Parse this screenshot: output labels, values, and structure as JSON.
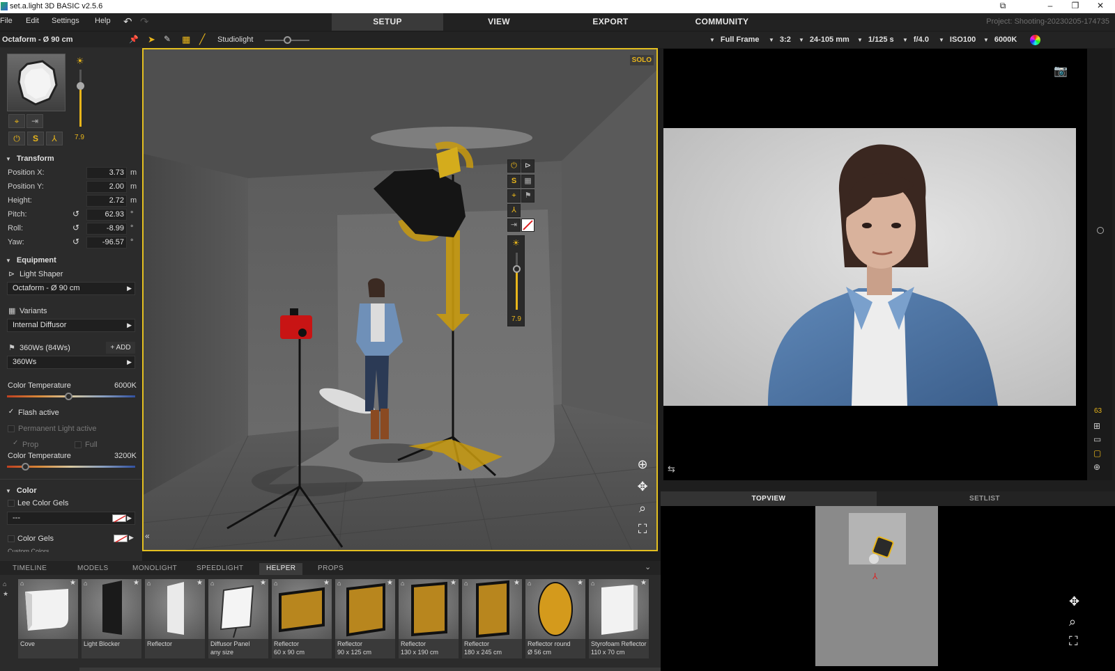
{
  "window": {
    "title": "set.a.light 3D BASIC v2.5.6"
  },
  "menu": {
    "items": [
      "File",
      "Edit",
      "Settings",
      "Help"
    ]
  },
  "main_tabs": [
    "SETUP",
    "VIEW",
    "EXPORT",
    "COMMUNITY"
  ],
  "project": "Project: Shooting-20230205-174735",
  "left_panel": {
    "header": "Octaform - Ø 90 cm",
    "power_value": "7.9",
    "transform": {
      "label": "Transform",
      "fields": [
        {
          "label": "Position X:",
          "value": "3.73",
          "unit": "m"
        },
        {
          "label": "Position Y:",
          "value": "2.00",
          "unit": "m"
        },
        {
          "label": "Height:",
          "value": "2.72",
          "unit": "m"
        },
        {
          "label": "Pitch:",
          "value": "62.93",
          "unit": "°"
        },
        {
          "label": "Roll:",
          "value": "-8.99",
          "unit": "°"
        },
        {
          "label": "Yaw:",
          "value": "-96.57",
          "unit": "°"
        }
      ]
    },
    "equipment": {
      "label": "Equipment",
      "light_shaper_label": "Light Shaper",
      "light_shaper_value": "Octaform - Ø 90 cm",
      "variants_label": "Variants",
      "variants_value": "Internal Diffusor",
      "flash_label": "360Ws (84Ws)",
      "add_label": "ADD",
      "flash_value": "360Ws",
      "color_temp_label": "Color Temperature",
      "color_temp_value": "6000K",
      "flash_active_label": "Flash active",
      "permanent_label": "Permanent Light active",
      "prop_label": "Prop",
      "full_label": "Full",
      "color_temp2_label": "Color Temperature",
      "color_temp2_value": "3200K"
    },
    "color": {
      "label": "Color",
      "lee_label": "Lee Color Gels",
      "lee_value": "---",
      "gels_label": "Color Gels",
      "custom_label": "Custom Colors"
    }
  },
  "viewport_toolbar": {
    "studiolight_label": "Studiolight"
  },
  "viewport": {
    "solo_label": "SOLO",
    "power_value": "7.9"
  },
  "bottom_tabs": [
    "TIMELINE",
    "MODELS",
    "MONOLIGHT",
    "SPEEDLIGHT",
    "HELPER",
    "PROPS"
  ],
  "shelf_items": [
    {
      "name": "Cove",
      "sub": ""
    },
    {
      "name": "Light Blocker",
      "sub": ""
    },
    {
      "name": "Reflector",
      "sub": ""
    },
    {
      "name": "Diffusor Panel",
      "sub": "any size"
    },
    {
      "name": "Reflector",
      "sub": "60 x 90 cm"
    },
    {
      "name": "Reflector",
      "sub": "90 x 125 cm"
    },
    {
      "name": "Reflector",
      "sub": "130 x 190 cm"
    },
    {
      "name": "Reflector",
      "sub": "180 x 245 cm"
    },
    {
      "name": "Reflector round",
      "sub": "Ø 56 cm"
    },
    {
      "name": "Styrofoam Reflector",
      "sub": "110 x 70 cm"
    }
  ],
  "camera": {
    "sensor": "Full Frame",
    "ratio": "3:2",
    "lens": "24-105 mm",
    "shutter": "1/125 s",
    "aperture": "f/4.0",
    "iso": "ISO100",
    "wb": "6000K",
    "zoom_value": "63"
  },
  "right_tabs": [
    "TOPVIEW",
    "SETLIST"
  ],
  "colors": {
    "accent": "#e8b51b",
    "panel": "#2b2b2b",
    "bar": "#232323"
  }
}
